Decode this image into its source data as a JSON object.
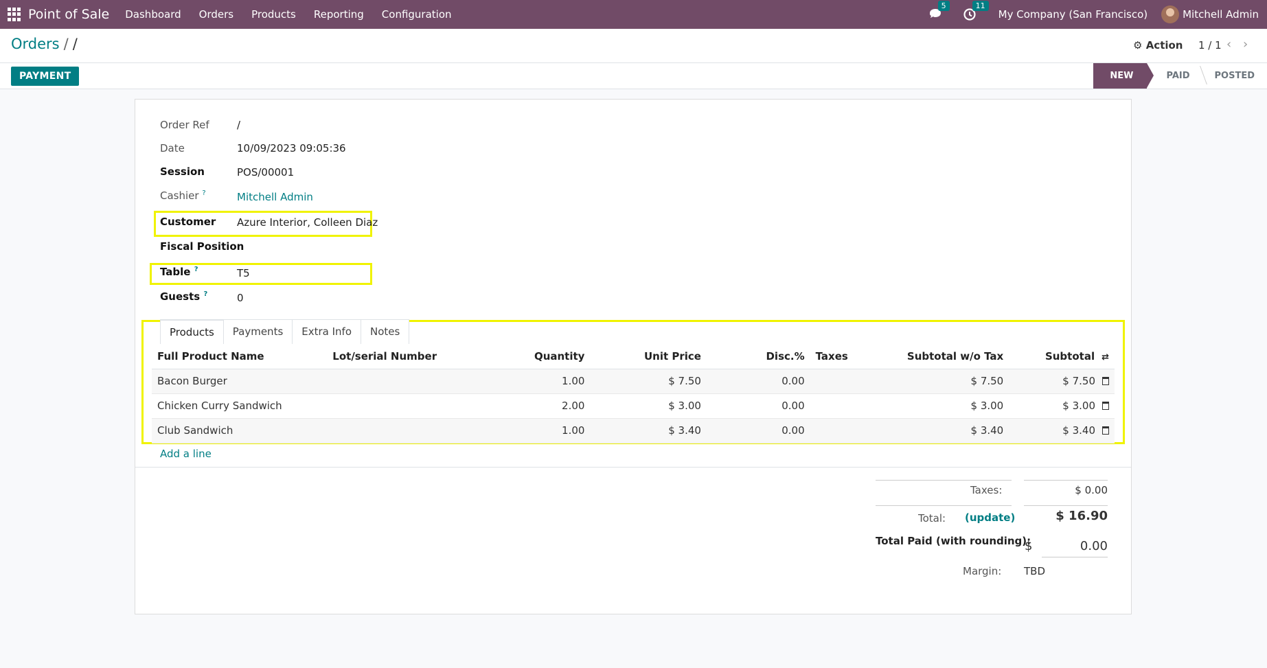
{
  "navbar": {
    "app_name": "Point of Sale",
    "menu": [
      "Dashboard",
      "Orders",
      "Products",
      "Reporting",
      "Configuration"
    ],
    "messages_count": "5",
    "activities_count": "11",
    "company": "My Company (San Francisco)",
    "user": "Mitchell Admin"
  },
  "control": {
    "breadcrumb_root": "Orders",
    "breadcrumb_current": "/",
    "action_label": "Action",
    "pager": "1 / 1"
  },
  "statusbar": {
    "payment_label": "PAYMENT",
    "stages": [
      "NEW",
      "PAID",
      "POSTED"
    ],
    "active_stage": "NEW"
  },
  "form": {
    "order_ref_label": "Order Ref",
    "order_ref": "/",
    "date_label": "Date",
    "date": "10/09/2023 09:05:36",
    "session_label": "Session",
    "session": "POS/00001",
    "cashier_label": "Cashier",
    "cashier": "Mitchell Admin",
    "customer_label": "Customer",
    "customer": "Azure Interior, Colleen Diaz",
    "fiscal_label": "Fiscal Position",
    "table_label": "Table",
    "table": "T5",
    "guests_label": "Guests",
    "guests": "0",
    "help_mark": "?"
  },
  "tabs": [
    "Products",
    "Payments",
    "Extra Info",
    "Notes"
  ],
  "lines": {
    "headers": {
      "product": "Full Product Name",
      "lot": "Lot/serial Number",
      "qty": "Quantity",
      "price": "Unit Price",
      "disc": "Disc.%",
      "taxes": "Taxes",
      "subtotal_wo": "Subtotal w/o Tax",
      "subtotal": "Subtotal"
    },
    "rows": [
      {
        "product": "Bacon Burger",
        "qty": "1.00",
        "price": "$ 7.50",
        "disc": "0.00",
        "subtotal_wo": "$ 7.50",
        "subtotal": "$ 7.50"
      },
      {
        "product": "Chicken Curry Sandwich",
        "qty": "2.00",
        "price": "$ 3.00",
        "disc": "0.00",
        "subtotal_wo": "$ 3.00",
        "subtotal": "$ 3.00"
      },
      {
        "product": "Club Sandwich",
        "qty": "1.00",
        "price": "$ 3.40",
        "disc": "0.00",
        "subtotal_wo": "$ 3.40",
        "subtotal": "$ 3.40"
      }
    ],
    "add_line": "Add a line"
  },
  "totals": {
    "taxes_label": "Taxes:",
    "taxes": "$ 0.00",
    "total_label": "Total:",
    "update_label": "(update)",
    "total": "$ 16.90",
    "paid_label": "Total Paid (with rounding):",
    "paid_currency": "$",
    "paid": "0.00",
    "margin_label": "Margin:",
    "margin": "TBD"
  },
  "colors": {
    "navbar": "#714b67",
    "accent": "#017e84",
    "highlight": "#f0f300"
  }
}
